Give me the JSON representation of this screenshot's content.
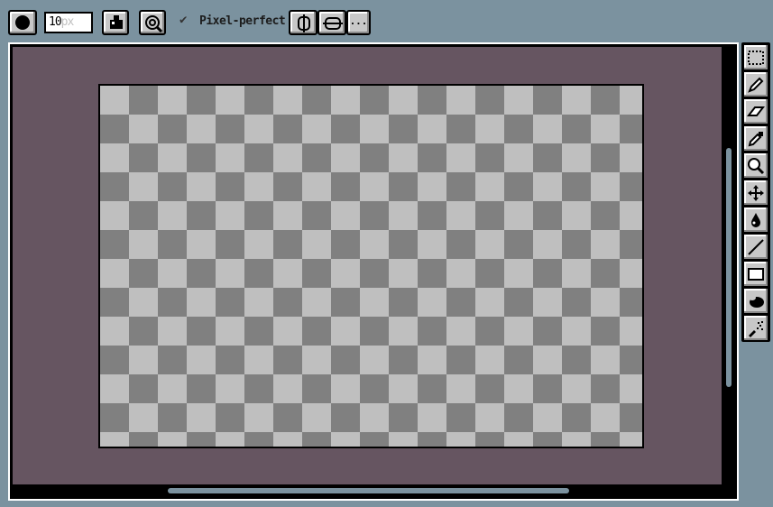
{
  "toolbar": {
    "brush_shape_icon": "circle-brush-icon",
    "brush_size_value": "10",
    "brush_size_unit": "px",
    "ink_icon": "ink-bottle-icon",
    "pixel_perfect_checked": true,
    "pixel_perfect_label": "Pixel-perfect",
    "symmetry_vertical_icon": "vertical-symmetry-icon",
    "symmetry_horizontal_icon": "horizontal-symmetry-icon",
    "more_label": "..."
  },
  "colors": {
    "background": "#7b929f",
    "viewport": "#665561",
    "checker_light": "#bfbfbf",
    "checker_dark": "#808080"
  },
  "tools": [
    "rectangular-marquee-icon",
    "pencil-icon",
    "eraser-icon",
    "eyedropper-icon",
    "zoom-icon",
    "move-icon",
    "paint-bucket-icon",
    "line-icon",
    "rectangle-icon",
    "ellipse-icon",
    "spray-icon"
  ]
}
